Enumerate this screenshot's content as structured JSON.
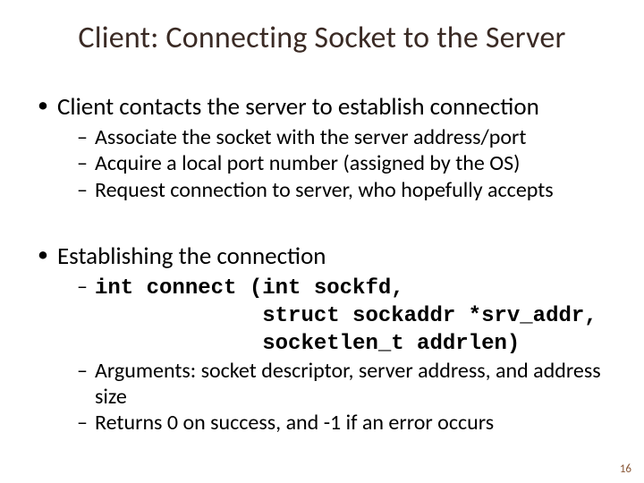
{
  "title": "Client: Connecting Socket to the Server",
  "b1": {
    "heading": "Client contacts the server to establish connection",
    "items": [
      "Associate the socket with the server address/port",
      "Acquire a local port number (assigned by the OS)",
      "Request connection to server, who hopefully accepts"
    ]
  },
  "b2": {
    "heading": "Establishing the connection",
    "code": "int connect (int sockfd,\n             struct sockaddr *srv_addr,\n             socketlen_t addrlen)",
    "items": [
      "Arguments: socket descriptor, server address, and address size",
      "Returns 0 on success, and -1 if an error occurs"
    ]
  },
  "page_number": "16"
}
